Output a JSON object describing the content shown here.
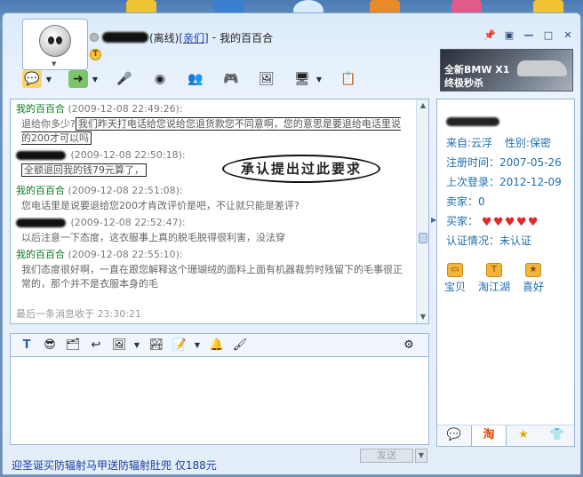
{
  "window": {
    "status": "(离线)",
    "relation": "[亲们]",
    "separator": "-",
    "contact_name": "我的百百合",
    "buttons": {
      "pin": "📌",
      "skin": "▣",
      "minimize": "—",
      "maximize": "□",
      "close": "✕"
    }
  },
  "toolbar": {
    "icons": [
      "chat-bubble-icon",
      "transfer-icon",
      "microphone-icon",
      "webcam-icon",
      "add-contact-icon",
      "gamepad-icon",
      "image-icon",
      "remote-icon",
      "notes-icon"
    ]
  },
  "ad": {
    "line1": "全新BMW X1",
    "line2": "终极秒杀"
  },
  "history": {
    "messages": [
      {
        "sender": "我的百百合",
        "time": "(2009-12-08 22:49:26):",
        "text_plain": "退给你多少?",
        "text_boxed": "我们昨天打电话给您说给您退货款您不同意啊，您的意思是要退给电话里说的200才可以吗"
      },
      {
        "sender": "",
        "time": "(2009-12-08 22:50:18):",
        "text_boxed": "全额退回我的钱79元算了，"
      },
      {
        "sender": "我的百百合",
        "time": "(2009-12-08 22:51:08):",
        "text_plain": "您电话里是说要退给您200才肯改评价是吧，不让就只能是差评?"
      },
      {
        "sender": "",
        "time": "(2009-12-08 22:52:47):",
        "text_plain": "以后注意一下态度，这衣服事上真的脱毛脱得很利害，没法穿"
      },
      {
        "sender": "我的百百合",
        "time": "(2009-12-08 22:55:10):",
        "text_plain": "我们态度很好啊，一直在跟您解释这个珊瑚绒的面料上面有机器裁剪时残留下的毛事很正常的，那个并不是衣服本身的毛"
      }
    ],
    "annotation": "承认提出过此要求",
    "last_message": "最后一条消息收于",
    "last_time": "23:30:21"
  },
  "input_toolbar": {
    "icons": [
      "font-icon",
      "emoji-icon",
      "screenshot-icon",
      "shake-icon",
      "image-icon",
      "folder-image-icon",
      "notes-icon",
      "bell-icon",
      "brush-icon",
      "settings-icon"
    ]
  },
  "send": {
    "label": "发送",
    "arrow": "▼"
  },
  "bottom_link": "迎圣诞买防辐射马甲送防辐射肚兜 仅188元",
  "panel": {
    "rows": [
      {
        "label": "来自:",
        "value": "云浮",
        "label2": "性别:",
        "value2": "保密"
      },
      {
        "label": "注册时间：",
        "value": "2007-05-26"
      },
      {
        "label": "上次登录：",
        "value": "2012-12-09"
      },
      {
        "label": "卖家：",
        "value": "0"
      },
      {
        "label": "买家：",
        "value": ""
      },
      {
        "label": "认证情况：",
        "value": "未认证"
      }
    ],
    "buyer_hearts": 5,
    "links": [
      {
        "label": "宝贝",
        "icon": "bag-icon"
      },
      {
        "label": "淘江湖",
        "icon": "smile-icon"
      },
      {
        "label": "喜好",
        "icon": "star-box-icon"
      }
    ],
    "tabs": [
      "chat-tab-icon",
      "taobao-tab-icon",
      "star-tab-icon",
      "clothes-tab-icon"
    ]
  },
  "colors": {
    "sender_green": "#0a7a1e",
    "link_blue": "#1a3e9c",
    "info_blue": "#1e6fb0",
    "heart_red": "#e02a2a"
  }
}
